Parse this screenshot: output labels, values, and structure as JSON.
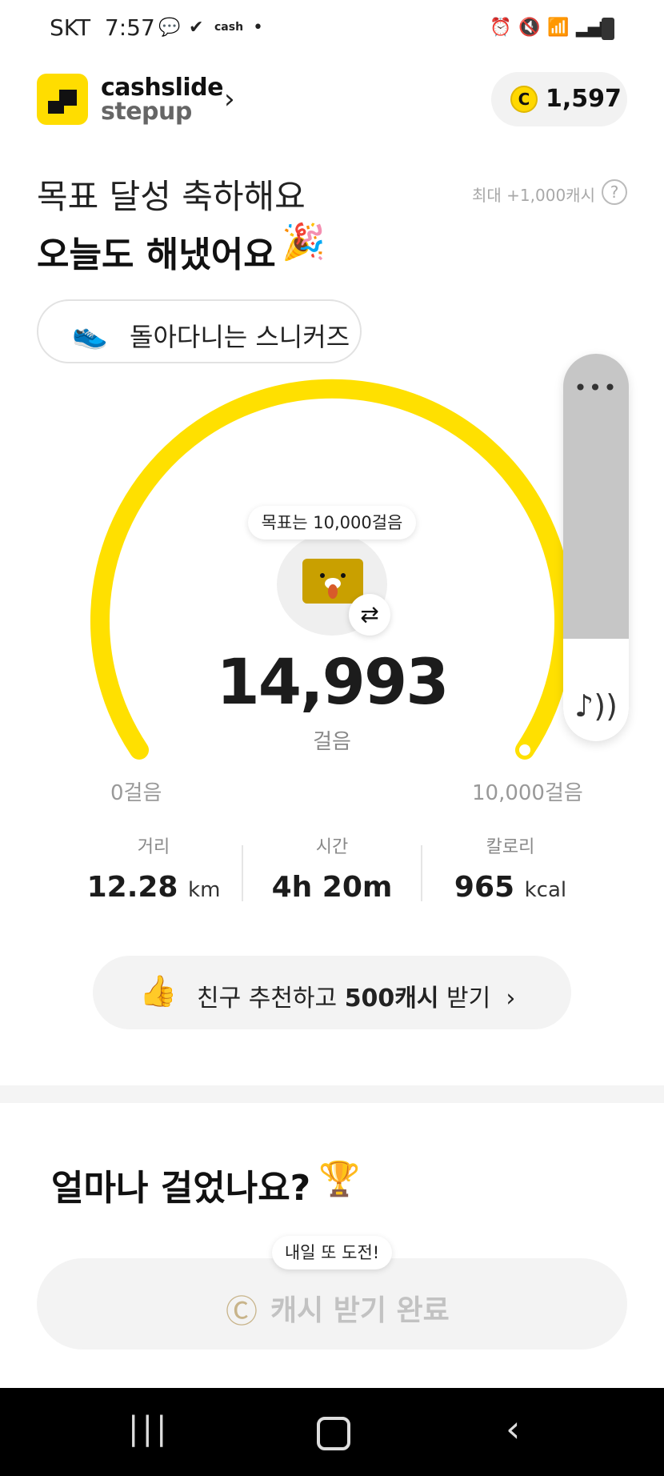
{
  "status_bar": {
    "carrier": "SKT",
    "time": "7:57",
    "icons": [
      "kakaotalk-icon",
      "vibe-icon",
      "cashfeed-icon",
      "dot-icon",
      "alarm-icon",
      "mute-icon",
      "wifi-icon",
      "signal-icon",
      "battery-icon"
    ]
  },
  "header": {
    "brand_line1": "cashslide",
    "brand_line2": "stepup",
    "coin_symbol": "C",
    "cash_balance": "1,597"
  },
  "headline": {
    "line1": "목표 달성 축하해요",
    "line2": "오늘도 해냈어요",
    "max_info": "최대 +1,000캐시",
    "help": "?"
  },
  "shoe": {
    "label": "돌아다니는 스니커즈"
  },
  "gauge": {
    "goal_bubble": "목표는 10,000걸음",
    "steps": "14,993",
    "steps_unit": "걸음",
    "min_label": "0걸음",
    "max_label": "10,000걸음",
    "progress_fraction": 1.0,
    "color": "#ffe000"
  },
  "side_widget": {
    "menu": "•••",
    "sound": "♪))"
  },
  "stats": [
    {
      "label": "거리",
      "value": "12.28",
      "unit": "km"
    },
    {
      "label": "시간",
      "value": "4h 20m",
      "unit": ""
    },
    {
      "label": "칼로리",
      "value": "965",
      "unit": "kcal"
    }
  ],
  "refer": {
    "text_pre": "친구 추천하고 ",
    "text_bold": "500캐시",
    "text_post": " 받기",
    "chevron": "›"
  },
  "section": {
    "title": "얼마나 걸었나요?"
  },
  "claim": {
    "tag": "내일 또 도전!",
    "button": "캐시 받기 완료"
  },
  "nav": {
    "recents": "|||",
    "back": "‹"
  },
  "colors": {
    "accent": "#ffe000",
    "brand_yellow": "#ffdd00"
  }
}
